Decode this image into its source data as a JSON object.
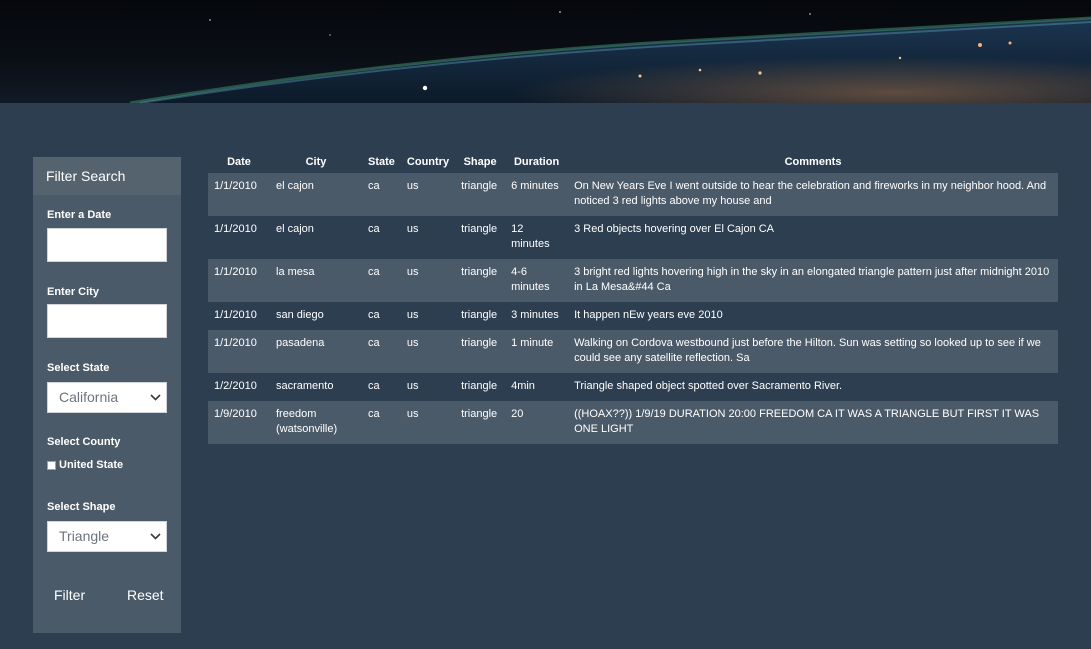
{
  "filter_panel": {
    "title": "Filter Search",
    "date_label": "Enter a Date",
    "date_value": "",
    "city_label": "Enter City",
    "city_value": "",
    "state_label": "Select State",
    "state_selected": "California",
    "county_label": "Select County",
    "county_checkbox_label": "United State",
    "county_checked": false,
    "shape_label": "Select Shape",
    "shape_selected": "Triangle",
    "filter_button": "Filter",
    "reset_button": "Reset"
  },
  "table": {
    "headers": [
      "Date",
      "City",
      "State",
      "Country",
      "Shape",
      "Duration",
      "Comments"
    ],
    "rows": [
      {
        "date": "1/1/2010",
        "city": "el cajon",
        "state": "ca",
        "country": "us",
        "shape": "triangle",
        "duration": "6 minutes",
        "comments": "On New Years Eve I went outside to hear the celebration and fireworks in my neighbor hood. And noticed 3 red lights above my house and"
      },
      {
        "date": "1/1/2010",
        "city": "el cajon",
        "state": "ca",
        "country": "us",
        "shape": "triangle",
        "duration": "12 minutes",
        "comments": "3 Red objects hovering over El Cajon CA"
      },
      {
        "date": "1/1/2010",
        "city": "la mesa",
        "state": "ca",
        "country": "us",
        "shape": "triangle",
        "duration": "4-6 minutes",
        "comments": "3 bright red lights hovering high in the sky in an elongated triangle pattern just after midnight 2010 in La Mesa&#44 Ca"
      },
      {
        "date": "1/1/2010",
        "city": "san diego",
        "state": "ca",
        "country": "us",
        "shape": "triangle",
        "duration": "3 minutes",
        "comments": "It happen nEw years eve 2010"
      },
      {
        "date": "1/1/2010",
        "city": "pasadena",
        "state": "ca",
        "country": "us",
        "shape": "triangle",
        "duration": "1 minute",
        "comments": "Walking on Cordova westbound just before the Hilton. Sun was setting so looked up to see if we could see any satellite reflection. Sa"
      },
      {
        "date": "1/2/2010",
        "city": "sacramento",
        "state": "ca",
        "country": "us",
        "shape": "triangle",
        "duration": "4min",
        "comments": "Triangle shaped object spotted over Sacramento River."
      },
      {
        "date": "1/9/2010",
        "city": "freedom (watsonville)",
        "state": "ca",
        "country": "us",
        "shape": "triangle",
        "duration": "20",
        "comments": "((HOAX??)) 1/9/19 DURATION 20:00 FREEDOM CA IT WAS A TRIANGLE BUT FIRST IT WAS ONE LIGHT"
      }
    ]
  },
  "icons": {
    "select_chevron": "chevron-down-icon"
  },
  "colors": {
    "page_background": "#2d3e50",
    "panel_background": "#4b5a69",
    "row_stripe": "#4b5a69"
  }
}
